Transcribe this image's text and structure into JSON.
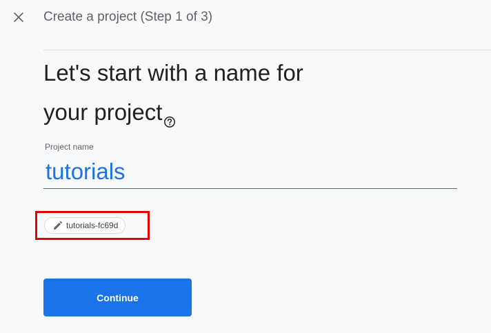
{
  "header": {
    "title": "Create a project (Step 1 of 3)",
    "close_icon": "close-icon"
  },
  "main": {
    "heading_line1": "Let's start with a name for",
    "heading_line2": "your project",
    "help_icon": "help-circle-icon"
  },
  "form": {
    "project_name_label": "Project name",
    "project_name_value": "tutorials",
    "project_id": "tutorials-fc69d",
    "project_id_icon": "pencil-icon"
  },
  "actions": {
    "continue_label": "Continue"
  },
  "colors": {
    "accent": "#1a73e8",
    "highlight": "#e60000",
    "background": "#f8f9fa"
  }
}
